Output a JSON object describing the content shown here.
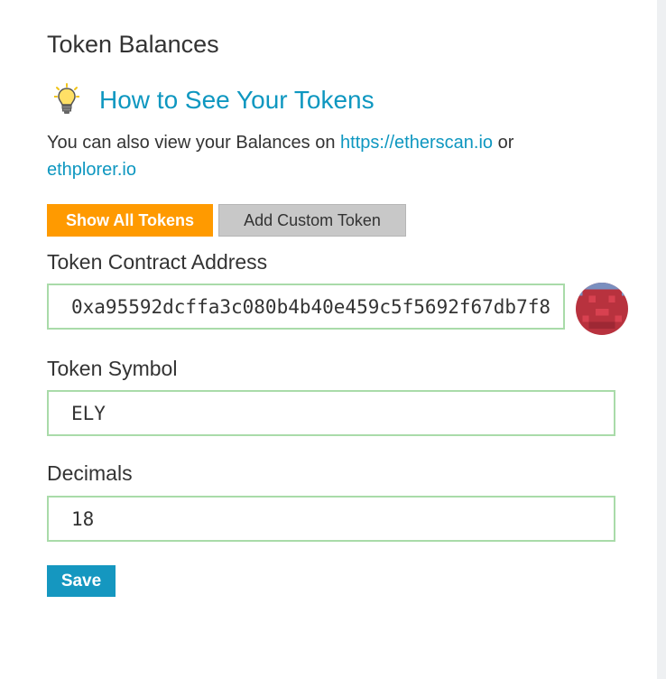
{
  "section": {
    "title": "Token Balances"
  },
  "howto": {
    "icon": "lightbulb-icon",
    "title": "How to See Your Tokens"
  },
  "description": {
    "prefix": "You can also view your Balances on ",
    "link1": "https://etherscan.io",
    "middle": " or",
    "link2": "ethplorer.io"
  },
  "tabs": {
    "show_all": "Show All Tokens",
    "add_custom": "Add Custom Token"
  },
  "form": {
    "address_label": "Token Contract Address",
    "address_value": "0xa95592dcffa3c080b4b40e459c5f5692f67db7f8",
    "symbol_label": "Token Symbol",
    "symbol_value": "ELY",
    "decimals_label": "Decimals",
    "decimals_value": "18",
    "save_label": "Save"
  },
  "colors": {
    "accent": "#0e97c0",
    "orange": "#ff9a00",
    "field_border": "#a9dba9",
    "save": "#1597c0"
  }
}
